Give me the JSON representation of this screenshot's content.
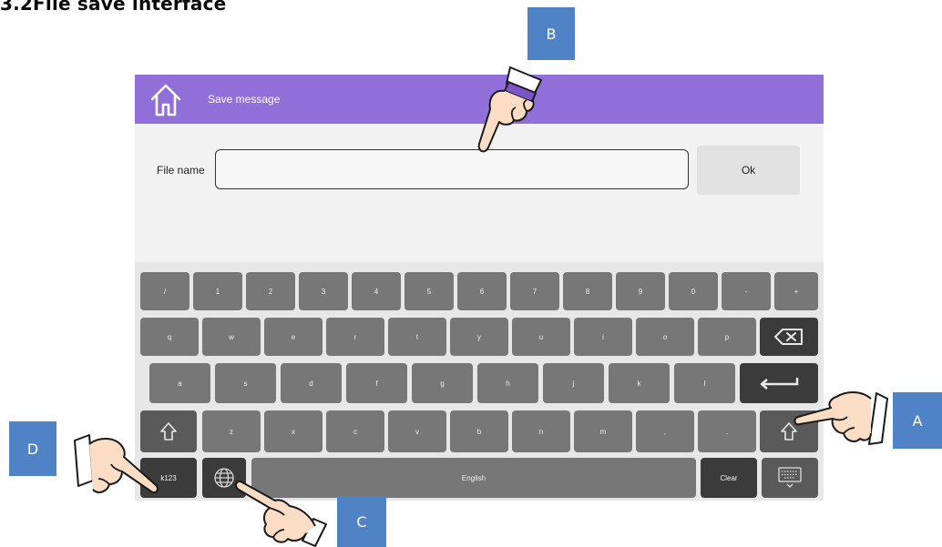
{
  "doc": {
    "heading": "3.2File save interface"
  },
  "titlebar": {
    "title": "Save message",
    "color": "#9070d8"
  },
  "form": {
    "filename_label": "File name",
    "filename_value": "",
    "ok_label": "Ok"
  },
  "keyboard": {
    "row1": [
      "/",
      "1",
      "2",
      "3",
      "4",
      "5",
      "6",
      "7",
      "8",
      "9",
      "0",
      "-",
      "+"
    ],
    "row2": [
      "q",
      "w",
      "e",
      "r",
      "t",
      "y",
      "u",
      "i",
      "o",
      "p"
    ],
    "row3": [
      "a",
      "s",
      "d",
      "f",
      "g",
      "h",
      "j",
      "k",
      "l"
    ],
    "row4": [
      "z",
      "x",
      "c",
      "v",
      "b",
      "n",
      "m",
      ",",
      "."
    ],
    "mode_key": "k123",
    "space_label": "English",
    "clear_label": "Clear"
  },
  "callouts": {
    "a": "A",
    "b": "B",
    "c": "C",
    "d": "D",
    "color": "#4f83c6"
  }
}
